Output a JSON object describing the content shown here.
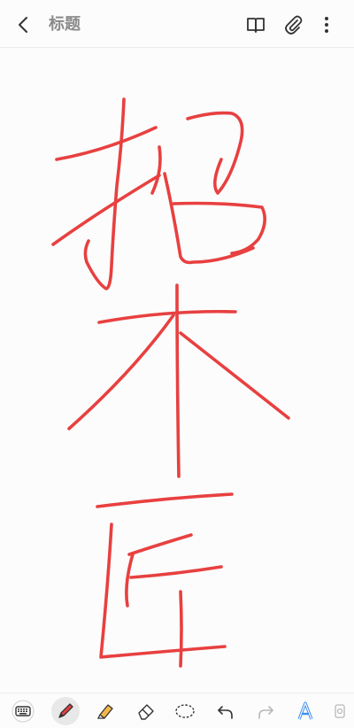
{
  "header": {
    "title": "标题",
    "back_icon": "chevron-left-icon",
    "reader_icon": "book-open-icon",
    "attach_icon": "paperclip-icon",
    "more_icon": "more-vertical-icon"
  },
  "note": {
    "handwriting_color": "#e84040",
    "handwritten_text": "招木匠"
  },
  "toolbar": {
    "tools": [
      {
        "name": "keyboard",
        "icon": "keyboard-icon",
        "active": false
      },
      {
        "name": "pen",
        "icon": "pen-icon",
        "active": true,
        "color": "#e84040"
      },
      {
        "name": "highlighter",
        "icon": "highlighter-icon",
        "active": false,
        "color": "#f2b84b"
      },
      {
        "name": "eraser",
        "icon": "eraser-icon",
        "active": false
      },
      {
        "name": "lasso",
        "icon": "lasso-select-icon",
        "active": false
      },
      {
        "name": "undo",
        "icon": "undo-icon",
        "active": false
      },
      {
        "name": "redo",
        "icon": "redo-icon",
        "active": false,
        "disabled": true
      },
      {
        "name": "text-style",
        "icon": "text-style-icon",
        "active": false,
        "color": "#3d8ef0"
      },
      {
        "name": "more-tools",
        "icon": "more-tools-icon",
        "active": false
      }
    ]
  }
}
